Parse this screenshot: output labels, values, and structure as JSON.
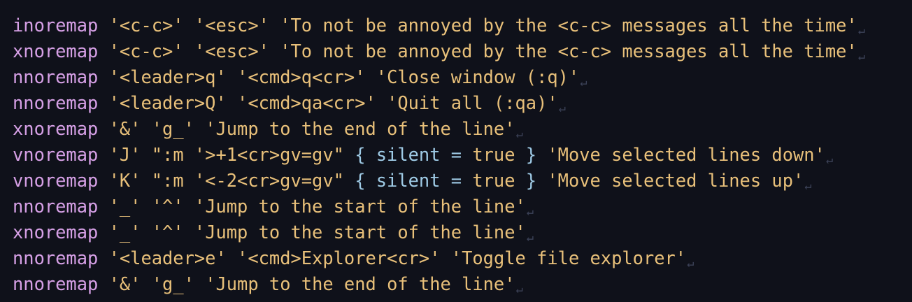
{
  "editor": {
    "newline_glyph": "↵",
    "lines": [
      {
        "segments": [
          {
            "t": "kw",
            "v": "inoremap"
          },
          {
            "t": "sp",
            "v": " "
          },
          {
            "t": "str",
            "v": "'<c-c>'"
          },
          {
            "t": "sp",
            "v": " "
          },
          {
            "t": "str",
            "v": "'<esc>'"
          },
          {
            "t": "sp",
            "v": " "
          },
          {
            "t": "str",
            "v": "'To not be annoyed by the <c-c> messages all the time'"
          }
        ]
      },
      {
        "segments": [
          {
            "t": "kw",
            "v": "xnoremap"
          },
          {
            "t": "sp",
            "v": " "
          },
          {
            "t": "str",
            "v": "'<c-c>'"
          },
          {
            "t": "sp",
            "v": " "
          },
          {
            "t": "str",
            "v": "'<esc>'"
          },
          {
            "t": "sp",
            "v": " "
          },
          {
            "t": "str",
            "v": "'To not be annoyed by the <c-c> messages all the time'"
          }
        ]
      },
      {
        "segments": [
          {
            "t": "kw",
            "v": "nnoremap"
          },
          {
            "t": "sp",
            "v": " "
          },
          {
            "t": "str",
            "v": "'<leader>q'"
          },
          {
            "t": "sp",
            "v": " "
          },
          {
            "t": "str",
            "v": "'<cmd>q<cr>'"
          },
          {
            "t": "sp",
            "v": " "
          },
          {
            "t": "str",
            "v": "'Close window (:q)'"
          }
        ]
      },
      {
        "segments": [
          {
            "t": "kw",
            "v": "nnoremap"
          },
          {
            "t": "sp",
            "v": " "
          },
          {
            "t": "str",
            "v": "'<leader>Q'"
          },
          {
            "t": "sp",
            "v": " "
          },
          {
            "t": "str",
            "v": "'<cmd>qa<cr>'"
          },
          {
            "t": "sp",
            "v": " "
          },
          {
            "t": "str",
            "v": "'Quit all (:qa)'"
          }
        ]
      },
      {
        "segments": [
          {
            "t": "kw",
            "v": "xnoremap"
          },
          {
            "t": "sp",
            "v": " "
          },
          {
            "t": "str",
            "v": "'&'"
          },
          {
            "t": "sp",
            "v": " "
          },
          {
            "t": "str",
            "v": "'g_'"
          },
          {
            "t": "sp",
            "v": " "
          },
          {
            "t": "str",
            "v": "'Jump to the end of the line'"
          }
        ]
      },
      {
        "segments": [
          {
            "t": "kw",
            "v": "vnoremap"
          },
          {
            "t": "sp",
            "v": " "
          },
          {
            "t": "str",
            "v": "'J'"
          },
          {
            "t": "sp",
            "v": " "
          },
          {
            "t": "str",
            "v": "\":m '>+1<cr>gv=gv\""
          },
          {
            "t": "sp",
            "v": " "
          },
          {
            "t": "punc",
            "v": "{ silent = "
          },
          {
            "t": "str",
            "v": "true"
          },
          {
            "t": "punc",
            "v": " }"
          },
          {
            "t": "sp",
            "v": " "
          },
          {
            "t": "str",
            "v": "'Move selected lines down'"
          }
        ]
      },
      {
        "segments": [
          {
            "t": "kw",
            "v": "vnoremap"
          },
          {
            "t": "sp",
            "v": " "
          },
          {
            "t": "str",
            "v": "'K'"
          },
          {
            "t": "sp",
            "v": " "
          },
          {
            "t": "str",
            "v": "\":m '<-2<cr>gv=gv\""
          },
          {
            "t": "sp",
            "v": " "
          },
          {
            "t": "punc",
            "v": "{ silent = "
          },
          {
            "t": "str",
            "v": "true"
          },
          {
            "t": "punc",
            "v": " }"
          },
          {
            "t": "sp",
            "v": " "
          },
          {
            "t": "str",
            "v": "'Move selected lines up'"
          }
        ]
      },
      {
        "segments": [
          {
            "t": "kw",
            "v": "nnoremap"
          },
          {
            "t": "sp",
            "v": " "
          },
          {
            "t": "str",
            "v": "'_'"
          },
          {
            "t": "sp",
            "v": " "
          },
          {
            "t": "str",
            "v": "'^'"
          },
          {
            "t": "sp",
            "v": " "
          },
          {
            "t": "str",
            "v": "'Jump to the start of the line'"
          }
        ]
      },
      {
        "segments": [
          {
            "t": "kw",
            "v": "xnoremap"
          },
          {
            "t": "sp",
            "v": " "
          },
          {
            "t": "str",
            "v": "'_'"
          },
          {
            "t": "sp",
            "v": " "
          },
          {
            "t": "str",
            "v": "'^'"
          },
          {
            "t": "sp",
            "v": " "
          },
          {
            "t": "str",
            "v": "'Jump to the start of the line'"
          }
        ]
      },
      {
        "segments": [
          {
            "t": "kw",
            "v": "nnoremap"
          },
          {
            "t": "sp",
            "v": " "
          },
          {
            "t": "str",
            "v": "'<leader>e'"
          },
          {
            "t": "sp",
            "v": " "
          },
          {
            "t": "str",
            "v": "'<cmd>Explorer<cr>'"
          },
          {
            "t": "sp",
            "v": " "
          },
          {
            "t": "str",
            "v": "'Toggle file explorer'"
          }
        ]
      },
      {
        "segments": [
          {
            "t": "kw",
            "v": "nnoremap"
          },
          {
            "t": "sp",
            "v": " "
          },
          {
            "t": "str",
            "v": "'&'"
          },
          {
            "t": "sp",
            "v": " "
          },
          {
            "t": "str",
            "v": "'g_'"
          },
          {
            "t": "sp",
            "v": " "
          },
          {
            "t": "str",
            "v": "'Jump to the end of the line'"
          }
        ]
      }
    ]
  },
  "colors": {
    "background": "#0f111a",
    "keyword": "#d6a0e6",
    "string": "#e8c07a",
    "punctuation": "#9fcbe6",
    "newline_marker": "#3c4258"
  }
}
